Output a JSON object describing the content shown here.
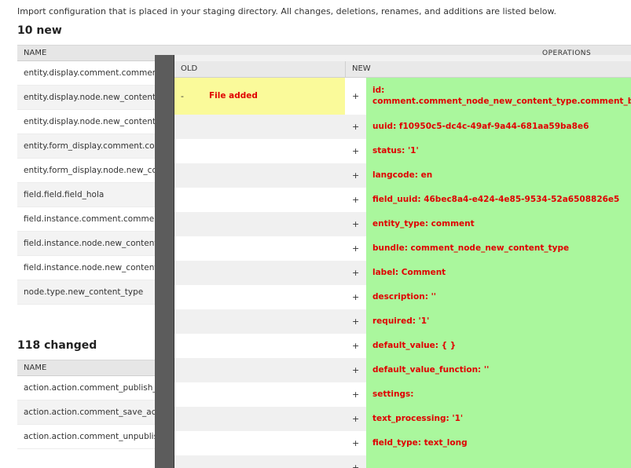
{
  "intro": "Import configuration that is placed in your staging directory. All changes, deletions, renames, and additions are listed below.",
  "new_section": {
    "heading": "10 new",
    "col_name": "NAME",
    "col_ops": "OPERATIONS",
    "rows": [
      "entity.display.comment.comment_node_new_content_type.default",
      "entity.display.node.new_content_type.default",
      "entity.display.node.new_content_type.teaser",
      "entity.form_display.comment.comment_node_new_content_type.default",
      "entity.form_display.node.new_content_type.default",
      "field.field.field_hola",
      "field.instance.comment.comment_node_new_content_type.comment_body",
      "field.instance.node.new_content_type.body",
      "field.instance.node.new_content_type.field_hola",
      "node.type.new_content_type"
    ]
  },
  "changed_section": {
    "heading": "118 changed",
    "col_name": "NAME",
    "rows": [
      "action.action.comment_publish_action",
      "action.action.comment_save_action",
      "action.action.comment_unpublish_action"
    ]
  },
  "diff": {
    "col_old": "OLD",
    "col_new": "NEW",
    "old_sign": "-",
    "old_text": "File added",
    "new_sign": "+",
    "lines": [
      "id: comment.comment_node_new_content_type.comment_body",
      "uuid: f10950c5-dc4c-49af-9a44-681aa59ba8e6",
      "status: '1'",
      "langcode: en",
      "field_uuid: 46bec8a4-e424-4e85-9534-52a6508826e5",
      "entity_type: comment",
      "bundle: comment_node_new_content_type",
      "label: Comment",
      "description: ''",
      "required: '1'",
      "default_value: {  }",
      "default_value_function: ''",
      "settings:",
      "text_processing: '1'",
      "field_type: text_long",
      ""
    ]
  }
}
